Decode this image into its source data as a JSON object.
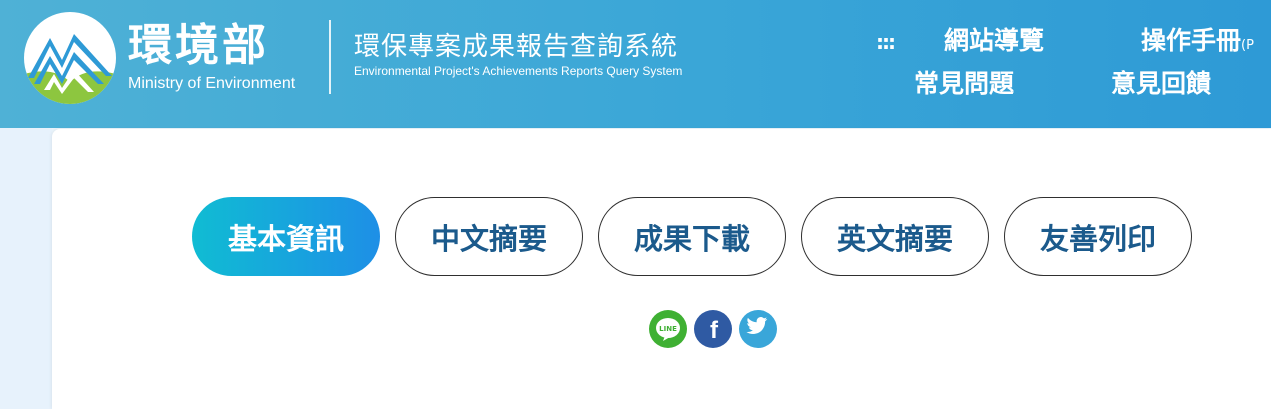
{
  "header": {
    "brand_zh": "環境部",
    "brand_en": "Ministry of Environment",
    "system_zh": "環保專案成果報告查詢系統",
    "system_en": "Environmental Project's Achievements Reports Query System",
    "nav": {
      "dots": ":::",
      "sitemap": "網站導覽",
      "manual": "操作手冊",
      "manual_suffix": "(P",
      "faq": "常見問題",
      "feedback": "意見回饋"
    }
  },
  "tabs": [
    {
      "label": "基本資訊",
      "active": true
    },
    {
      "label": "中文摘要",
      "active": false
    },
    {
      "label": "成果下載",
      "active": false
    },
    {
      "label": "英文摘要",
      "active": false
    },
    {
      "label": "友善列印",
      "active": false
    }
  ],
  "share": {
    "line_text": "LINE",
    "facebook_glyph": "f",
    "icons": [
      "line-icon",
      "facebook-icon",
      "twitter-icon"
    ]
  },
  "colors": {
    "header": "#3aa6d7",
    "tab_text": "#1b5a8c",
    "tab_active_start": "#10bcd3",
    "tab_active_end": "#1e8fe6",
    "line": "#3fb033",
    "facebook": "#2f5aa3",
    "twitter": "#39a6d9"
  }
}
